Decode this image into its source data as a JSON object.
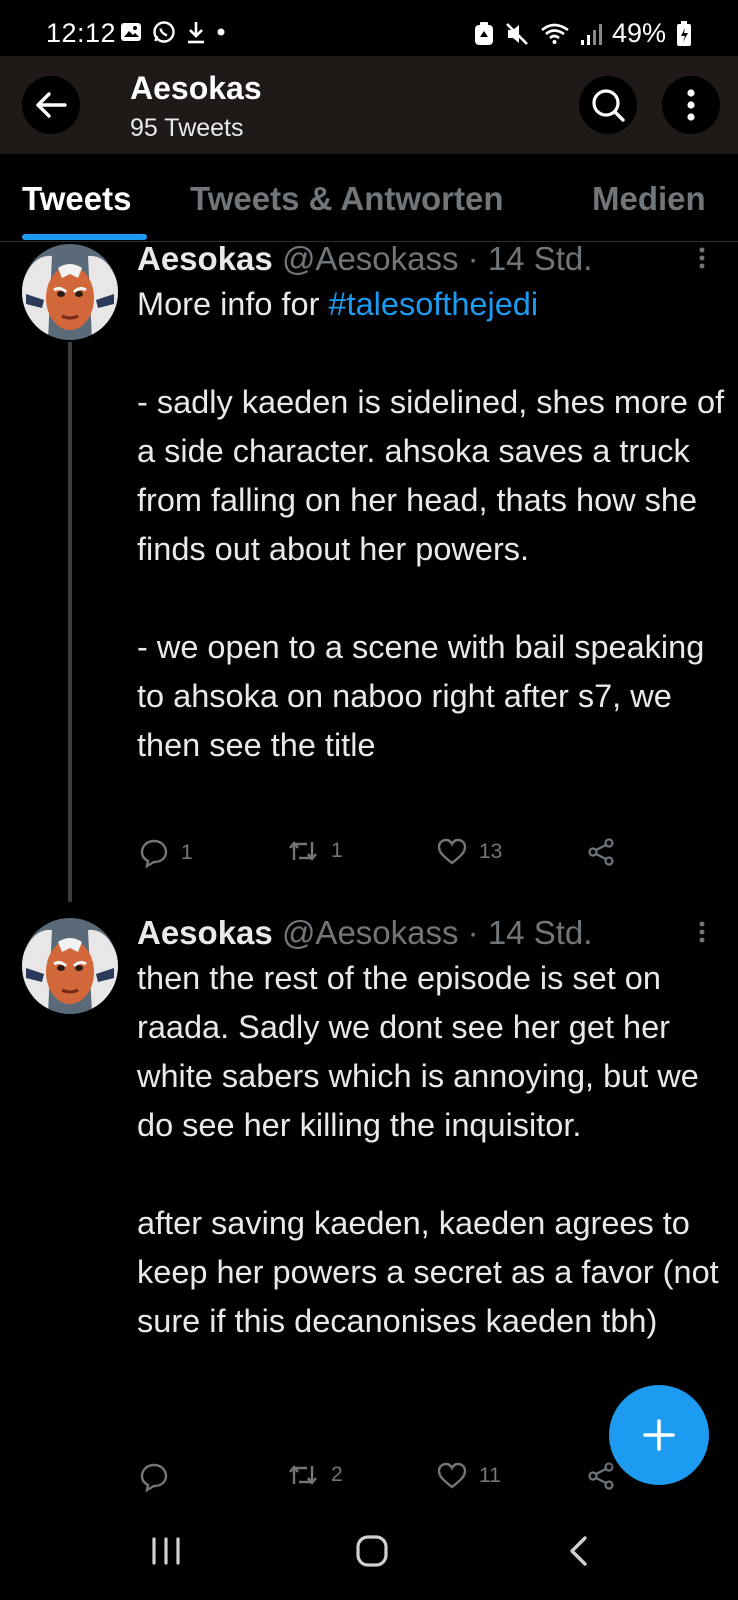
{
  "status_bar": {
    "time": "12:12",
    "battery": "49%",
    "left_icons": [
      "gallery-icon",
      "whatsapp-icon",
      "download-icon",
      "dot-icon"
    ],
    "right_icons": [
      "recycle-icon",
      "mute-icon",
      "wifi-icon",
      "signal-icon",
      "battery-icon"
    ]
  },
  "header": {
    "title": "Aesokas",
    "subtitle": "95 Tweets"
  },
  "tabs": [
    {
      "label": "Tweets",
      "active": true
    },
    {
      "label": "Tweets & Antworten",
      "active": false
    },
    {
      "label": "Medien",
      "active": false
    }
  ],
  "tweets": [
    {
      "name": "Aesokas",
      "meta": "@Aesokass · 14 Std.",
      "intro": "More info for ",
      "hashtag": "#talesofthejedi",
      "paragraphs": [
        "- sadly kaeden is sidelined, shes more of a side character. ahsoka saves a truck from falling on her head, thats how she finds out about her powers.",
        "- we open to a scene with bail speaking to ahsoka on naboo right after s7, we then see the title"
      ],
      "replies": "1",
      "retweets": "1",
      "likes": "13"
    },
    {
      "name": "Aesokas",
      "meta": "@Aesokass · 14 Std.",
      "paragraphs": [
        "then the rest of the episode is set on raada. Sadly we dont see her get her white sabers which is annoying, but we do see her killing the inquisitor.",
        "after saving kaeden, kaeden agrees to keep her powers a secret as a favor (not sure if this decanonises kaeden tbh)"
      ],
      "replies": "",
      "retweets": "2",
      "likes": "11"
    }
  ],
  "colors": {
    "accent": "#1d9bf0",
    "background": "#000000",
    "header_bg": "#1f1a18",
    "muted": "#71767b"
  }
}
